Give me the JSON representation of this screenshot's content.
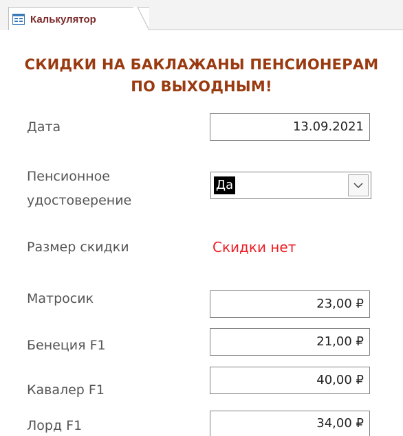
{
  "tab": {
    "label": "Калькулятор",
    "icon": "form-icon"
  },
  "form": {
    "title_line1": "СКИДКИ НА БАКЛАЖАНЫ ПЕНСИОНЕРАМ",
    "title_line2": "ПО ВЫХОДНЫМ!",
    "title_color": "#9a3a10"
  },
  "fields": {
    "date": {
      "label": "Дата",
      "value": "13.09.2021"
    },
    "pension": {
      "label_line1": "Пенсионное",
      "label_line2": "удостоверение",
      "value": "Да",
      "icon": "chevron-down-icon"
    },
    "discount": {
      "label": "Размер скидки",
      "value": "Скидки нет",
      "value_color": "#ed1c24"
    },
    "items": [
      {
        "label": "Матросик",
        "price": "23,00 ₽"
      },
      {
        "label": "Бенеция F1",
        "price": "21,00 ₽"
      },
      {
        "label": "Кавалер F1",
        "price": "40,00 ₽"
      },
      {
        "label": "Лорд F1",
        "price": "34,00 ₽"
      }
    ]
  }
}
